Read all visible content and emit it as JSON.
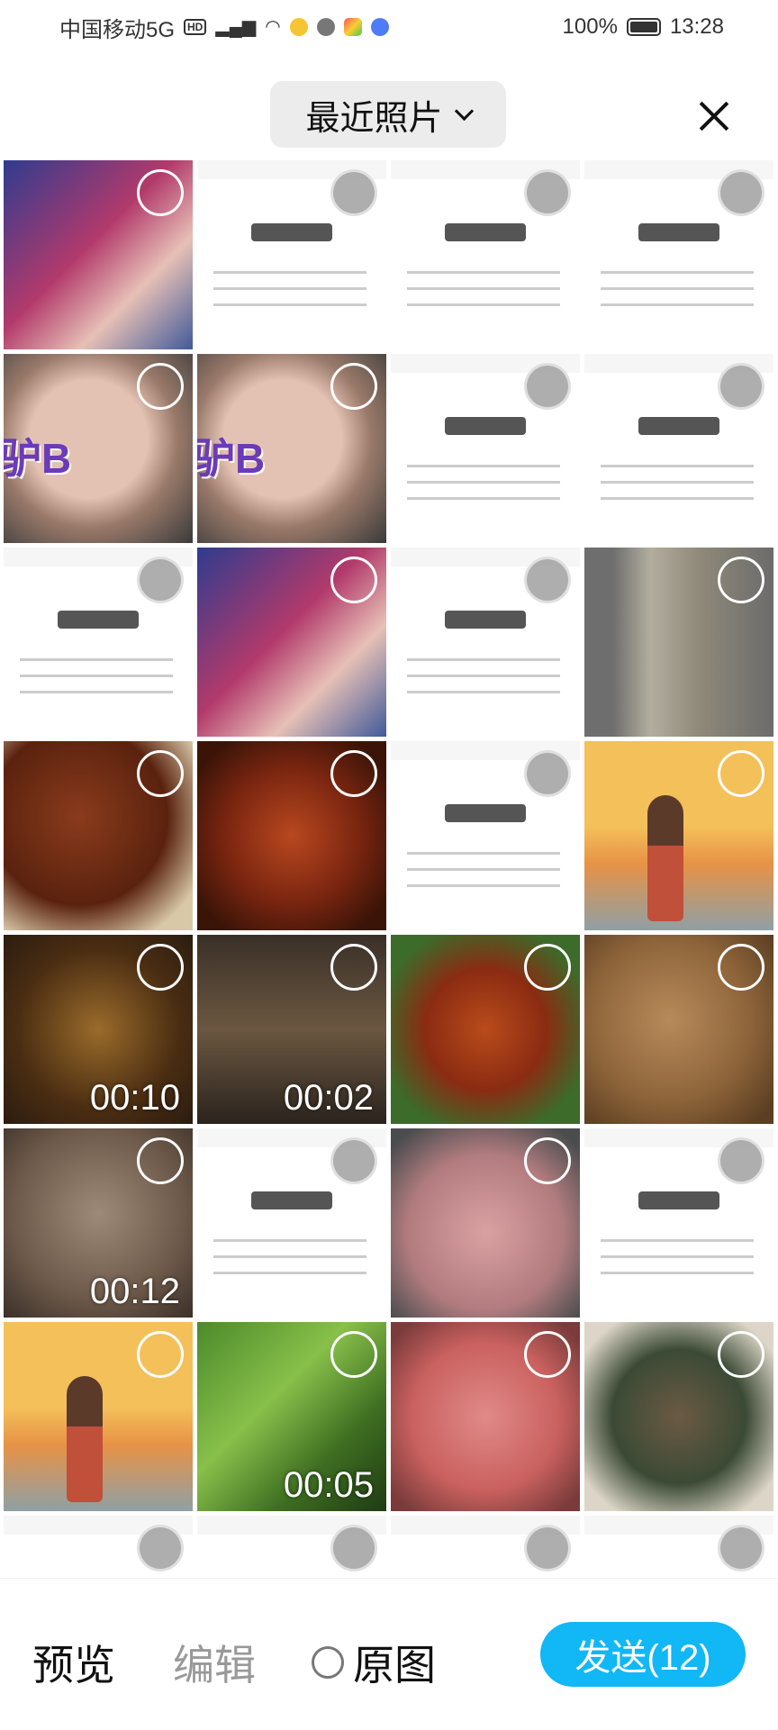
{
  "status_bar": {
    "carrier": "中国移动5G",
    "hd": "HD",
    "network": "5G",
    "battery": "100%",
    "time": "13:28"
  },
  "header": {
    "album_title": "最近照片"
  },
  "grid": {
    "items": [
      {
        "kind": "screen",
        "thumb": "t-stream",
        "selected_style": "outline",
        "duration": ""
      },
      {
        "kind": "screen",
        "thumb": "t-screen",
        "selected_style": "filled",
        "duration": ""
      },
      {
        "kind": "screen",
        "thumb": "t-screen",
        "selected_style": "filled",
        "duration": ""
      },
      {
        "kind": "screen",
        "thumb": "t-screen",
        "selected_style": "filled",
        "duration": ""
      },
      {
        "kind": "photo",
        "thumb": "t-face",
        "selected_style": "outline",
        "duration": ""
      },
      {
        "kind": "photo",
        "thumb": "t-face",
        "selected_style": "outline",
        "duration": ""
      },
      {
        "kind": "screen",
        "thumb": "t-screen",
        "selected_style": "filled",
        "duration": ""
      },
      {
        "kind": "screen",
        "thumb": "t-screen",
        "selected_style": "filled",
        "duration": ""
      },
      {
        "kind": "screen",
        "thumb": "t-screen",
        "selected_style": "filled",
        "duration": ""
      },
      {
        "kind": "screen",
        "thumb": "t-stream",
        "selected_style": "outline",
        "duration": ""
      },
      {
        "kind": "screen",
        "thumb": "t-screen",
        "selected_style": "filled",
        "duration": ""
      },
      {
        "kind": "photo",
        "thumb": "t-gray",
        "selected_style": "outline",
        "duration": ""
      },
      {
        "kind": "photo",
        "thumb": "t-food1",
        "selected_style": "outline",
        "duration": ""
      },
      {
        "kind": "photo",
        "thumb": "t-food2",
        "selected_style": "outline",
        "duration": ""
      },
      {
        "kind": "screen",
        "thumb": "t-screen",
        "selected_style": "filled",
        "duration": ""
      },
      {
        "kind": "photo",
        "thumb": "t-beach",
        "selected_style": "outline",
        "duration": ""
      },
      {
        "kind": "video",
        "thumb": "t-vid1",
        "selected_style": "outline",
        "duration": "00:10"
      },
      {
        "kind": "video",
        "thumb": "t-vid2",
        "selected_style": "outline",
        "duration": "00:02"
      },
      {
        "kind": "photo",
        "thumb": "t-soup",
        "selected_style": "outline",
        "duration": ""
      },
      {
        "kind": "photo",
        "thumb": "t-fried",
        "selected_style": "outline",
        "duration": ""
      },
      {
        "kind": "video",
        "thumb": "t-bubbles",
        "selected_style": "outline",
        "duration": "00:12"
      },
      {
        "kind": "screen",
        "thumb": "t-screen",
        "selected_style": "filled",
        "duration": ""
      },
      {
        "kind": "photo",
        "thumb": "t-meat",
        "selected_style": "outline",
        "duration": ""
      },
      {
        "kind": "screen",
        "thumb": "t-screen",
        "selected_style": "filled",
        "duration": ""
      },
      {
        "kind": "photo",
        "thumb": "t-beach",
        "selected_style": "outline",
        "duration": ""
      },
      {
        "kind": "video",
        "thumb": "t-pepper",
        "selected_style": "outline",
        "duration": "00:05"
      },
      {
        "kind": "photo",
        "thumb": "t-raw",
        "selected_style": "outline",
        "duration": ""
      },
      {
        "kind": "photo",
        "thumb": "t-greens",
        "selected_style": "outline",
        "duration": ""
      },
      {
        "kind": "screen",
        "thumb": "t-screen",
        "selected_style": "filled",
        "duration": ""
      },
      {
        "kind": "screen",
        "thumb": "t-screen",
        "selected_style": "filled",
        "duration": ""
      },
      {
        "kind": "screen",
        "thumb": "t-screen",
        "selected_style": "filled",
        "duration": ""
      },
      {
        "kind": "screen",
        "thumb": "t-screen",
        "selected_style": "filled",
        "duration": ""
      }
    ]
  },
  "bottom_bar": {
    "preview_label": "预览",
    "edit_label": "编辑",
    "original_label": "原图",
    "send_label": "发送(12)"
  },
  "colors": {
    "send_button": "#12b7f5",
    "edit_disabled": "#999999"
  }
}
